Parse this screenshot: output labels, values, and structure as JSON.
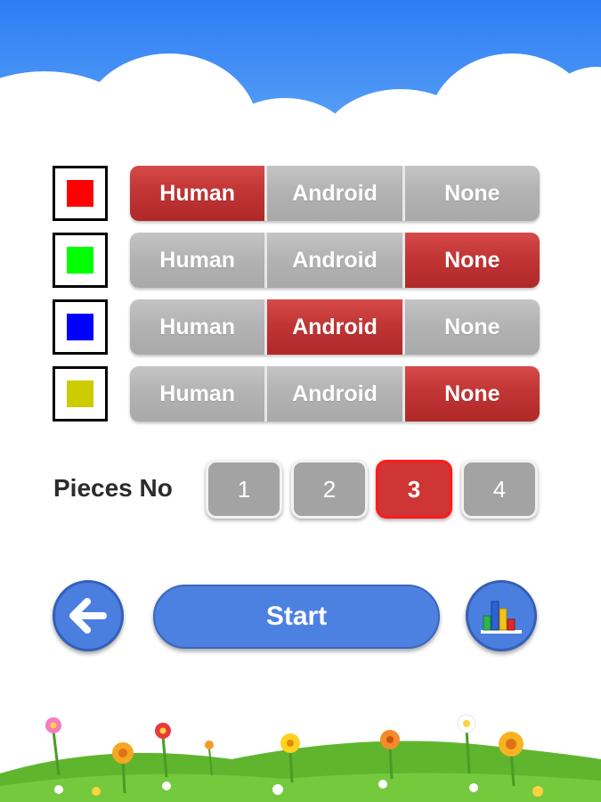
{
  "players": [
    {
      "color": "#ff0000",
      "options": [
        "Human",
        "Android",
        "None"
      ],
      "selected": 0
    },
    {
      "color": "#00ff00",
      "options": [
        "Human",
        "Android",
        "None"
      ],
      "selected": 2
    },
    {
      "color": "#0000ff",
      "options": [
        "Human",
        "Android",
        "None"
      ],
      "selected": 1
    },
    {
      "color": "#cccc00",
      "options": [
        "Human",
        "Android",
        "None"
      ],
      "selected": 2
    }
  ],
  "pieces": {
    "label": "Pieces No",
    "options": [
      "1",
      "2",
      "3",
      "4"
    ],
    "selected": 2
  },
  "controls": {
    "back_icon": "arrow-left-icon",
    "start_label": "Start",
    "stats_icon": "bar-chart-icon"
  },
  "colors": {
    "selected": "#c23535",
    "unselected": "#b3b3b3",
    "button_blue": "#4c80e1",
    "sky": "#2f7df6"
  }
}
